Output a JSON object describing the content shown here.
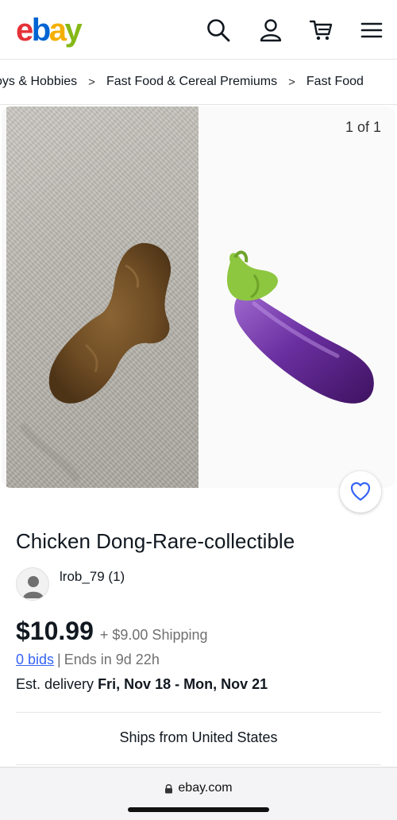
{
  "header": {
    "logo_letters": [
      "e",
      "b",
      "a",
      "y"
    ],
    "logo_colors": [
      "#e53238",
      "#0064d2",
      "#f5af02",
      "#86b817"
    ],
    "icons": [
      "search-icon",
      "account-icon",
      "cart-icon",
      "menu-icon"
    ]
  },
  "breadcrumbs": [
    "oys & Hobbies",
    "Fast Food & Cereal Premiums",
    "Fast Food"
  ],
  "breadcrumb_separator": ">",
  "gallery": {
    "counter": "1 of 1"
  },
  "listing": {
    "title": "Chicken Dong-Rare-collectible",
    "seller": "lrob_79 (1)",
    "price": "$10.99",
    "shipping": "+ $9.00 Shipping",
    "bids": "0 bids",
    "bids_separator": "|",
    "ends": "Ends in 9d 22h",
    "delivery_label": "Est. delivery",
    "delivery_date": "Fri, Nov 18 - Mon, Nov 21",
    "ships_from": "Ships from United States"
  },
  "browser": {
    "url": "ebay.com"
  },
  "colors": {
    "link": "#3665f3",
    "secondary_text": "#707070",
    "primary_text": "#111820"
  }
}
